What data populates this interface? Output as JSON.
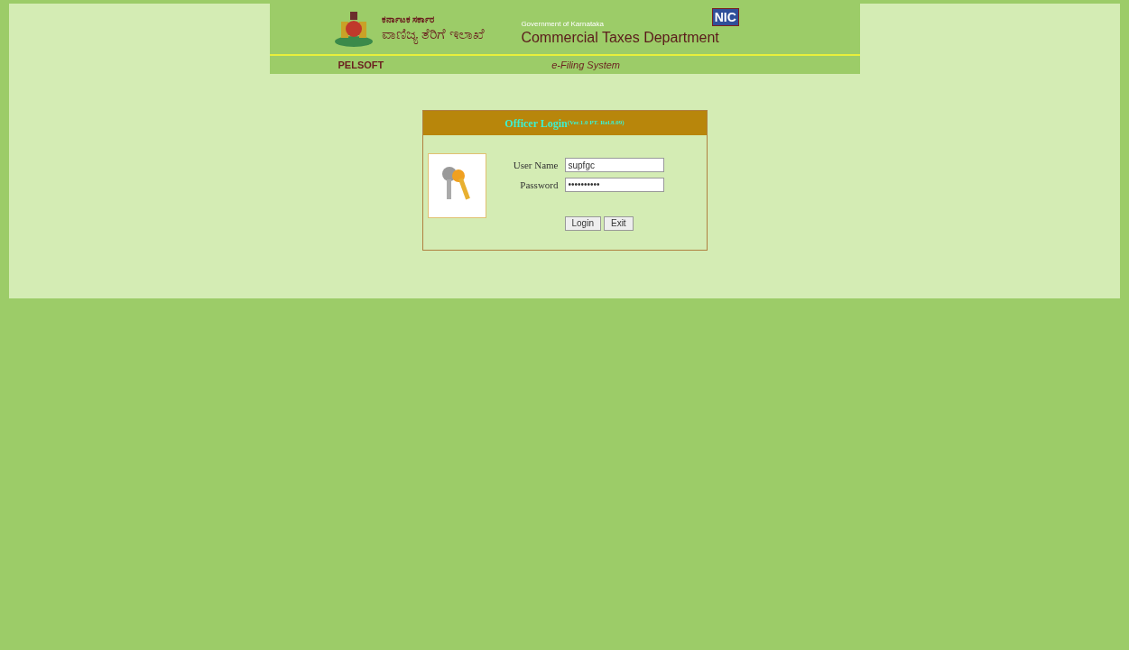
{
  "header": {
    "kannada_small": "ಕರ್ನಾಟಕ ಸರ್ಕಾರ",
    "kannada_large": "ವಾಣಿಜ್ಯ ತೆರಿಗೆ ಇಲಾಖೆ",
    "government": "Government of Karnataka",
    "department": "Commercial Taxes Department",
    "nic_logo": "NIC",
    "pelsoft": "PELSOFT",
    "system": "e-Filing System"
  },
  "login": {
    "title": "Officer Login",
    "version": "(Ver.1.0 PT. Rel.8.09)",
    "fields": [
      {
        "label": "User Name",
        "value": "supfgc"
      },
      {
        "label": "Password",
        "value": "••••••••••"
      }
    ],
    "buttons": [
      "Login",
      "Exit"
    ]
  }
}
